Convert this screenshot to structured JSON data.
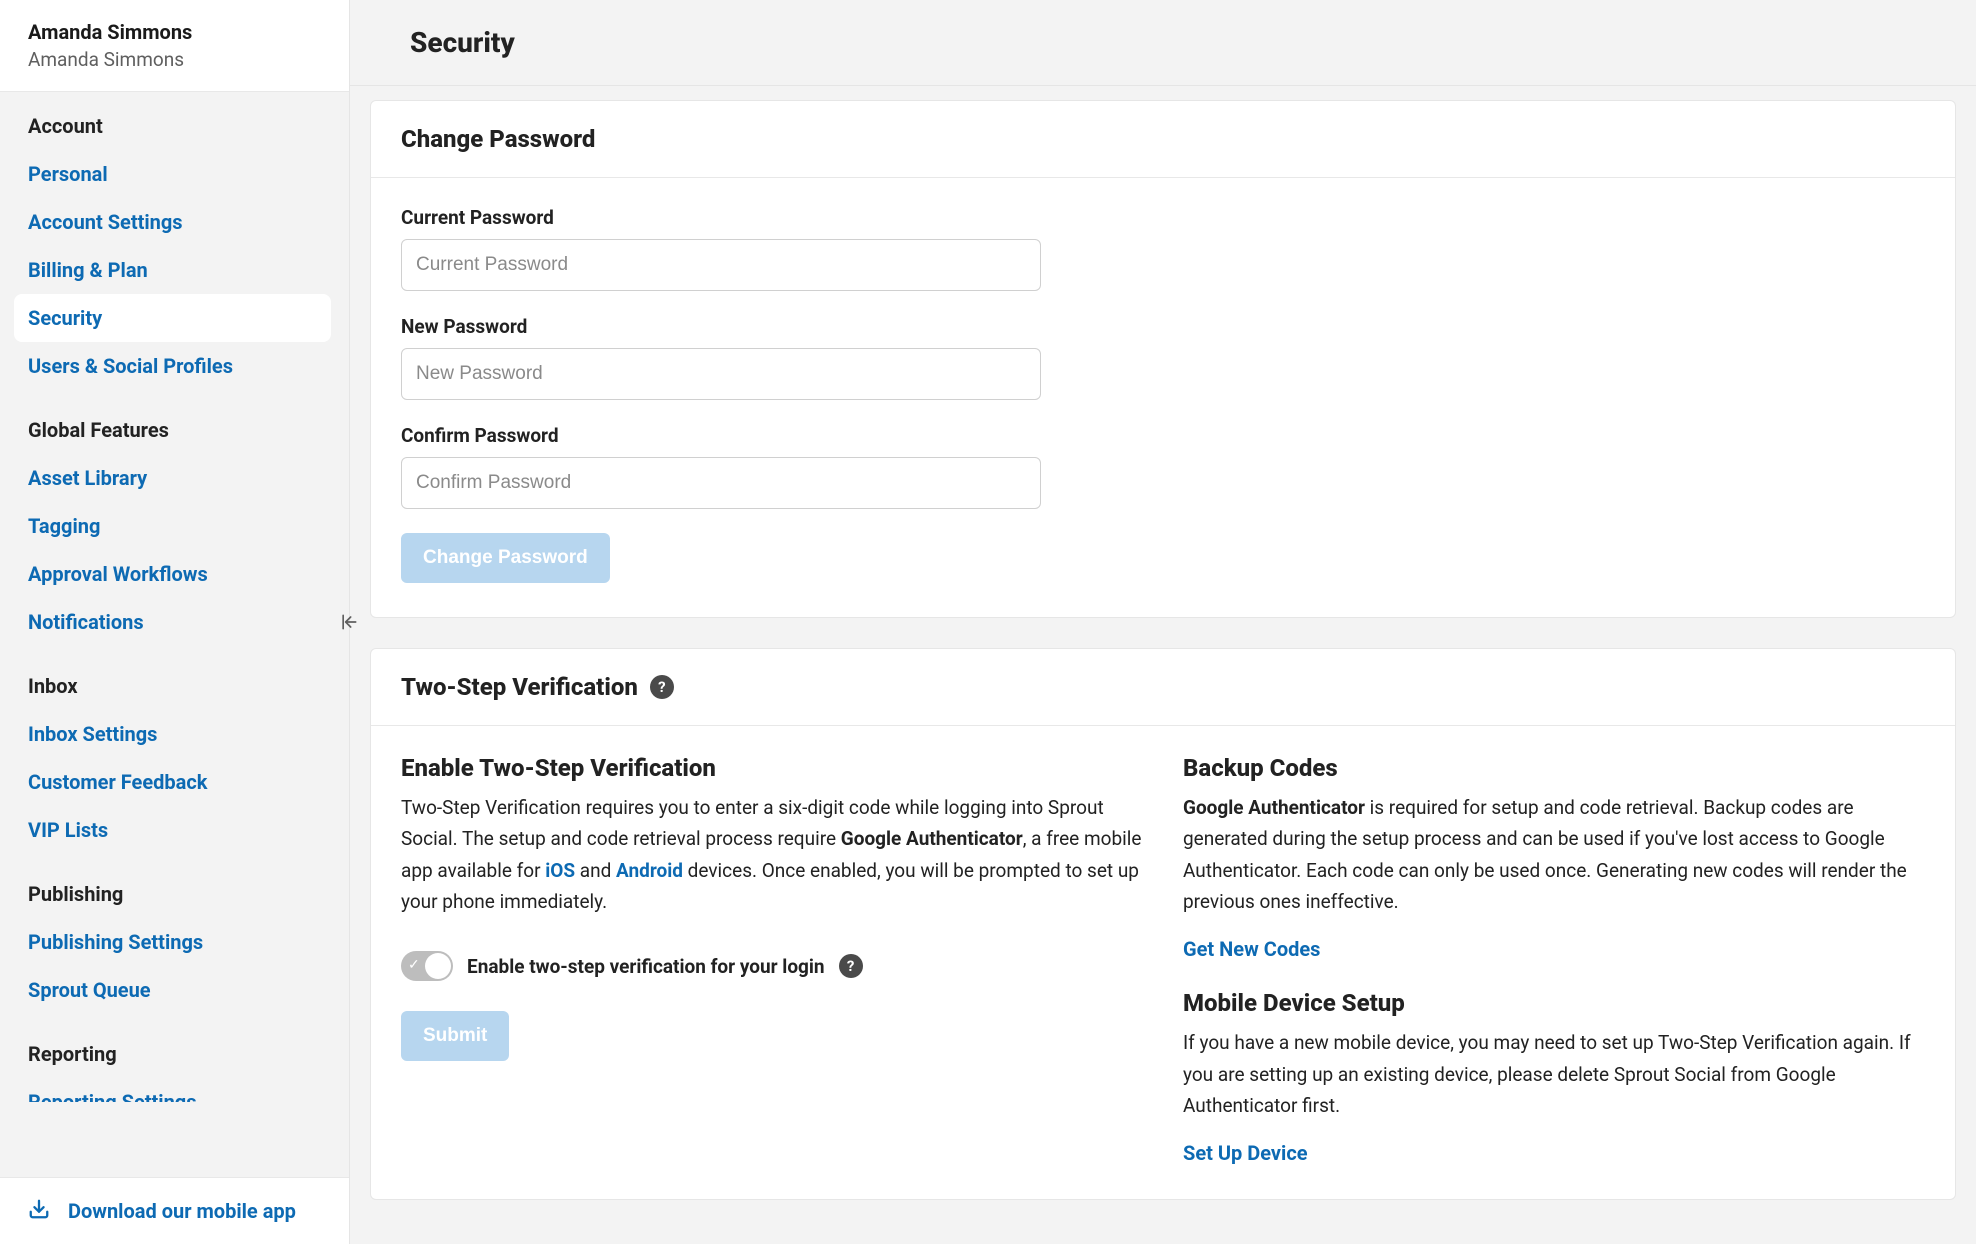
{
  "user": {
    "primary": "Amanda Simmons",
    "secondary": "Amanda Simmons"
  },
  "sidebar": {
    "sections": {
      "account": {
        "title": "Account",
        "items": [
          "Personal",
          "Account Settings",
          "Billing & Plan",
          "Security",
          "Users & Social Profiles"
        ]
      },
      "global": {
        "title": "Global Features",
        "items": [
          "Asset Library",
          "Tagging",
          "Approval Workflows",
          "Notifications"
        ]
      },
      "inbox": {
        "title": "Inbox",
        "items": [
          "Inbox Settings",
          "Customer Feedback",
          "VIP Lists"
        ]
      },
      "publishing": {
        "title": "Publishing",
        "items": [
          "Publishing Settings",
          "Sprout Queue"
        ]
      },
      "reporting": {
        "title": "Reporting",
        "cut_item": "Reporting Settings"
      }
    },
    "footer_link": "Download our mobile app"
  },
  "page": {
    "title": "Security"
  },
  "change_password": {
    "heading": "Change Password",
    "current_label": "Current Password",
    "current_placeholder": "Current Password",
    "new_label": "New Password",
    "new_placeholder": "New Password",
    "confirm_label": "Confirm Password",
    "confirm_placeholder": "Confirm Password",
    "button": "Change Password"
  },
  "two_step": {
    "heading": "Two-Step Verification",
    "enable_heading": "Enable Two-Step Verification",
    "enable_p1_a": "Two-Step Verification requires you to enter a six-digit code while logging into Sprout Social. The setup and code retrieval process require ",
    "enable_p1_strong": "Google Authenticator",
    "enable_p1_b": ", a free mobile app available for ",
    "enable_p1_ios": "iOS",
    "enable_p1_and": " and ",
    "enable_p1_android": "Android",
    "enable_p1_c": " devices. Once enabled, you will be prompted to set up your phone immediately.",
    "toggle_label": "Enable two-step verification for your login",
    "submit": "Submit",
    "backup_heading": "Backup Codes",
    "backup_p_strong": "Google Authenticator",
    "backup_p_rest": " is required for setup and code retrieval. Backup codes are generated during the setup process and can be used if you've lost access to Google Authenticator. Each code can only be used once. Generating new codes will render the previous ones ineffective.",
    "get_codes": "Get New Codes",
    "mobile_heading": "Mobile Device Setup",
    "mobile_p": "If you have a new mobile device, you may need to set up Two-Step Verification again. If you are setting up an existing device, please delete Sprout Social from Google Authenticator first.",
    "set_up": "Set Up Device"
  }
}
